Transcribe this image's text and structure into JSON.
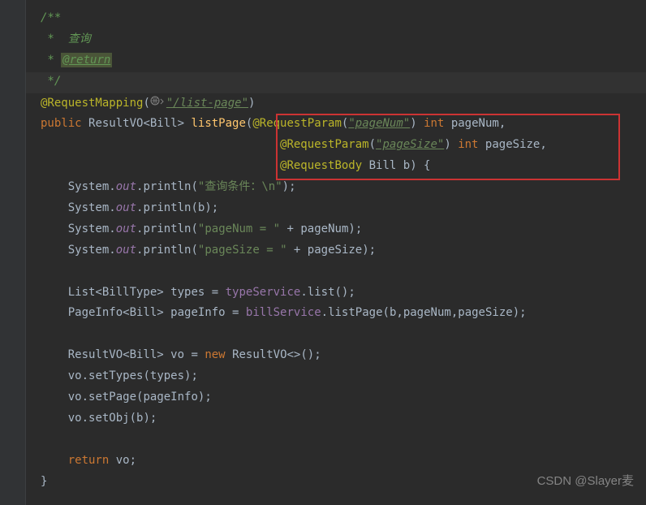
{
  "javadoc": {
    "open": "/**",
    "line1": " *  查询",
    "line2_prefix": " * ",
    "return_tag": "@return",
    "close": " */"
  },
  "mapping": {
    "annotation": "@RequestMapping",
    "url": "\"/list-page\""
  },
  "method_sig": {
    "public": "public",
    "return_type": "ResultVO<Bill>",
    "name": "listPage",
    "param1_anno": "@RequestParam",
    "param1_str": "\"pageNum\"",
    "param1_type": "int",
    "param1_name": "pageNum",
    "param2_anno": "@RequestParam",
    "param2_str": "\"pageSize\"",
    "param2_type": "int",
    "param2_name": "pageSize",
    "param3_anno": "@RequestBody",
    "param3_type": "Bill",
    "param3_name": "b"
  },
  "body": {
    "sys": "System",
    "out": "out",
    "println": "println",
    "str1": "\"查询条件：\\n\"",
    "str2": "\"pageNum = \"",
    "str3": "\"pageSize = \"",
    "plus": " + ",
    "var_b": "b",
    "var_pn": "pageNum",
    "var_ps": "pageSize",
    "list_type": "List<BillType>",
    "types_var": "types",
    "typeService": "typeService",
    "list_method": "list",
    "pageinfo_type": "PageInfo<Bill>",
    "pageinfo_var": "pageInfo",
    "billService": "billService",
    "listPage_m": "listPage",
    "result_type": "ResultVO<Bill>",
    "vo_var": "vo",
    "new_kw": "new",
    "result_ctor": "ResultVO<>",
    "setTypes": "setTypes",
    "setPage": "setPage",
    "setObj": "setObj",
    "return_kw": "return"
  },
  "watermark": "CSDN @Slayer麦"
}
